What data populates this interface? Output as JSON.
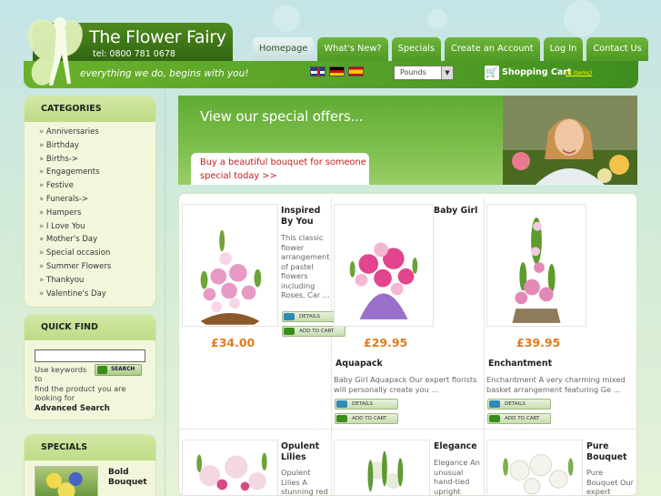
{
  "header": {
    "site_title": "The Flower Fairy",
    "phone": "tel: 0800 781 0678",
    "tagline": "everything we do, begins with you!"
  },
  "nav": {
    "items": [
      "Homepage",
      "What's New?",
      "Specials",
      "Create an Account",
      "Log In",
      "Contact Us"
    ],
    "active": "Homepage"
  },
  "currency": {
    "selected": "Pounds"
  },
  "cart": {
    "label": "Shopping Cart",
    "count": "(0 items)"
  },
  "sidebar": {
    "categories": {
      "title": "CATEGORIES",
      "items": [
        "Anniversaries",
        "Birthday",
        "Births->",
        "Engagements",
        "Festive",
        "Funerals->",
        "Hampers",
        "I Love You",
        "Mother's Day",
        "Special occasion",
        "Summer Flowers",
        "Thankyou",
        "Valentine's Day"
      ]
    },
    "quick_find": {
      "title": "QUICK FIND",
      "hint_line1": "Use keywords to",
      "hint_line2": "find the product you are looking for",
      "search_label": "SEARCH",
      "advanced": "Advanced Search"
    },
    "specials": {
      "title": "SPECIALS",
      "item_name": "Bold Bouquet"
    }
  },
  "banner": {
    "title": "View our special offers...",
    "subtitle": "Buy a beautiful bouquet for someone special today  >>"
  },
  "buttons": {
    "details": "DETAILS",
    "add_to_cart": "ADD TO CART"
  },
  "products": [
    {
      "name": "Inspired By You",
      "desc": "This classic flower arrangement of pastel flowers including Roses, Car ...",
      "price": "£34.00"
    },
    {
      "name": "Baby Girl Aquapack",
      "desc": "Baby Girl Aquapack Our expert florists will personally create you ...",
      "price": "£29.95"
    },
    {
      "name": "Enchantment",
      "desc": "Enchantment A very charming mixed basket arrangement featuring Ge ...",
      "price": "£39.95"
    },
    {
      "name": "Opulent Lilies",
      "desc": "Opulent Lilies A stunning red",
      "price": ""
    },
    {
      "name": "Elegance",
      "desc": "Elegance An unusual hand-tied upright",
      "price": ""
    },
    {
      "name": "Pure Bouquet",
      "desc": "Pure Bouquet Our expert",
      "price": ""
    }
  ],
  "colors": {
    "price": "#e27a1c",
    "header_green": "#4d9a22",
    "banner_red": "#c81c1c"
  }
}
